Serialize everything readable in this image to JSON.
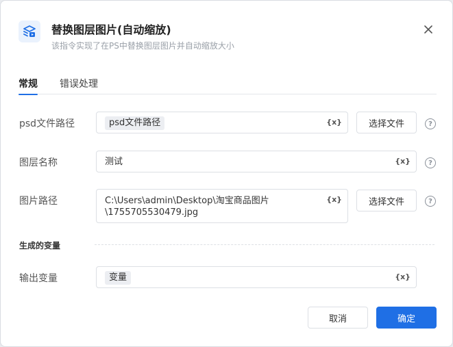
{
  "dialog": {
    "title": "替换图层图片(自动缩放)",
    "subtitle": "该指令实现了在PS中替换图层图片并自动缩放大小",
    "icon": "layers-icon",
    "close_icon": "close-icon"
  },
  "tabs": [
    {
      "label": "常规",
      "active": true
    },
    {
      "label": "错误处理",
      "active": false
    }
  ],
  "fields": {
    "psd_path": {
      "label": "psd文件路径",
      "value": "psd文件路径",
      "button": "选择文件"
    },
    "layer_name": {
      "label": "图层名称",
      "value": "测试"
    },
    "image_path": {
      "label": "图片路径",
      "value_line1": "C:\\Users\\admin\\Desktop\\淘宝商品图片",
      "value_line2": "\\1755705530479.jpg",
      "button": "选择文件"
    }
  },
  "output": {
    "section_title": "生成的变量",
    "label": "输出变量",
    "value": "变量"
  },
  "var_symbol": "{x}",
  "help_symbol": "?",
  "footer": {
    "cancel": "取消",
    "confirm": "确定"
  },
  "colors": {
    "accent": "#1f6fe5"
  }
}
